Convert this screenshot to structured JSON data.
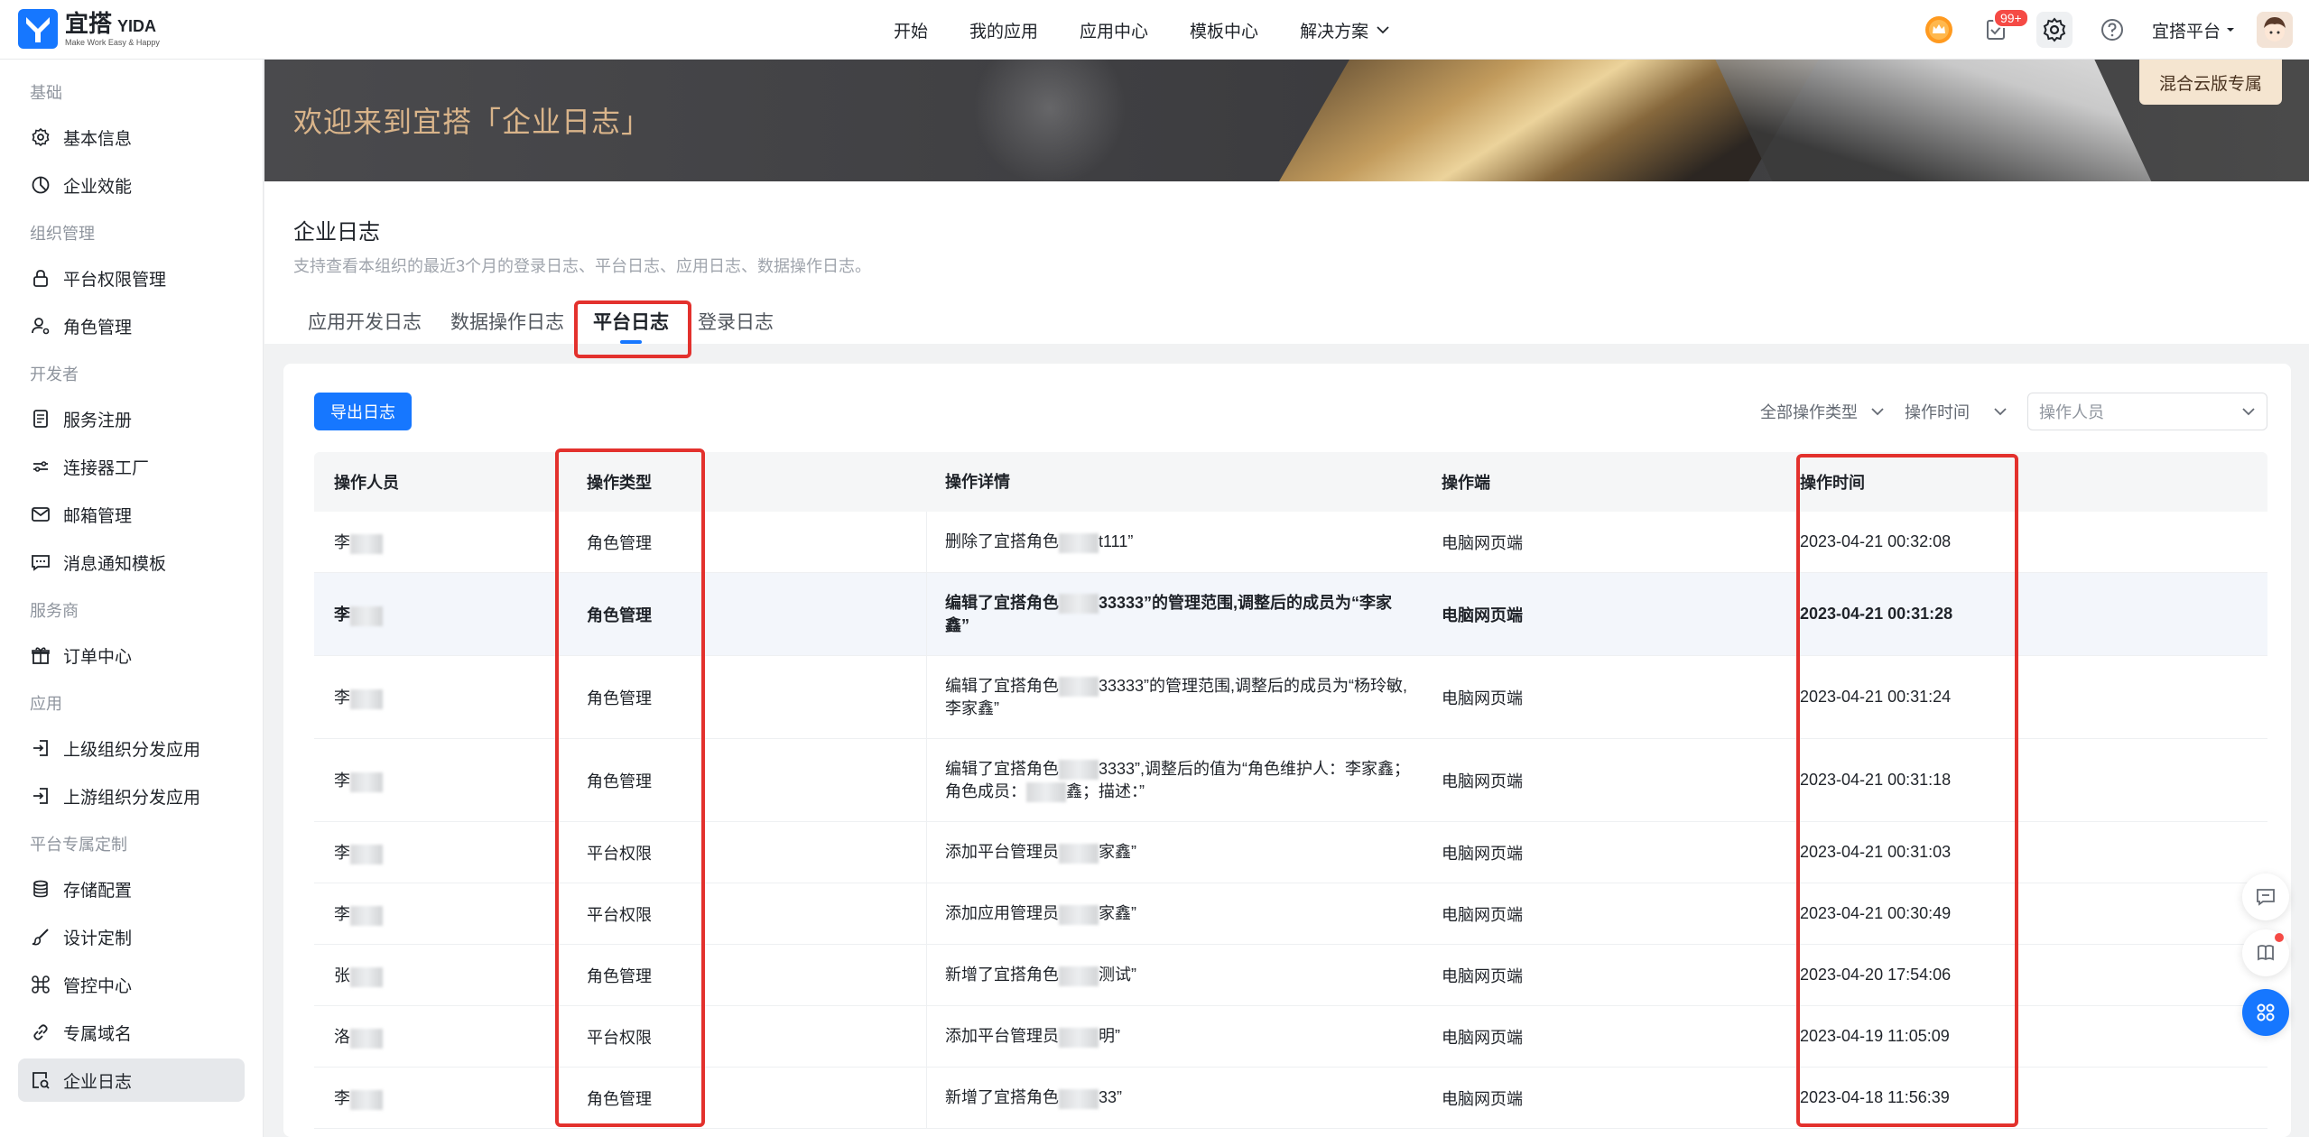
{
  "logo": {
    "cn": "宜搭",
    "en": "YIDA",
    "slogan": "Make Work Easy & Happy"
  },
  "topnav": {
    "items": [
      {
        "label": "开始"
      },
      {
        "label": "我的应用"
      },
      {
        "label": "应用中心"
      },
      {
        "label": "模板中心"
      },
      {
        "label": "解决方案"
      }
    ],
    "notification_badge": "99+",
    "org_name": "宜搭平台"
  },
  "sidebar": {
    "groups": [
      {
        "title": "基础",
        "items": [
          {
            "label": "基本信息",
            "icon": "gear-icon"
          },
          {
            "label": "企业效能",
            "icon": "pie-chart-icon"
          }
        ]
      },
      {
        "title": "组织管理",
        "items": [
          {
            "label": "平台权限管理",
            "icon": "lock-icon"
          },
          {
            "label": "角色管理",
            "icon": "user-gear-icon"
          }
        ]
      },
      {
        "title": "开发者",
        "items": [
          {
            "label": "服务注册",
            "icon": "document-icon"
          },
          {
            "label": "连接器工厂",
            "icon": "connector-icon"
          },
          {
            "label": "邮箱管理",
            "icon": "mail-icon"
          },
          {
            "label": "消息通知模板",
            "icon": "message-icon"
          }
        ]
      },
      {
        "title": "服务商",
        "items": [
          {
            "label": "订单中心",
            "icon": "gift-icon"
          }
        ]
      },
      {
        "title": "应用",
        "items": [
          {
            "label": "上级组织分发应用",
            "icon": "login-icon"
          },
          {
            "label": "上游组织分发应用",
            "icon": "login-icon"
          }
        ]
      },
      {
        "title": "平台专属定制",
        "items": [
          {
            "label": "存储配置",
            "icon": "database-icon"
          },
          {
            "label": "设计定制",
            "icon": "brush-icon"
          },
          {
            "label": "管控中心",
            "icon": "command-icon"
          },
          {
            "label": "专属域名",
            "icon": "link-icon"
          },
          {
            "label": "企业日志",
            "icon": "log-search-icon"
          }
        ]
      }
    ],
    "active_item": "企业日志"
  },
  "banner": {
    "title": "欢迎来到宜搭「企业日志」",
    "cloud_badge": "混合云版专属"
  },
  "page": {
    "title": "企业日志",
    "description": "支持查看本组织的最近3个月的登录日志、平台日志、应用日志、数据操作日志。",
    "tabs": [
      {
        "label": "应用开发日志"
      },
      {
        "label": "数据操作日志"
      },
      {
        "label": "平台日志"
      },
      {
        "label": "登录日志"
      }
    ],
    "active_tab": "平台日志"
  },
  "toolbar": {
    "export_label": "导出日志",
    "filter_type": "全部操作类型",
    "filter_time": "操作时间",
    "filter_operator_placeholder": "操作人员"
  },
  "table": {
    "columns": [
      "操作人员",
      "操作类型",
      "操作详情",
      "操作端",
      "操作时间"
    ],
    "rows": [
      {
        "operator": "李",
        "type": "角色管理",
        "detail_a": "删除了宜搭角色",
        "detail_b": "t111”",
        "client": "电脑网页端",
        "time": "2023-04-21 00:32:08"
      },
      {
        "operator": "李",
        "type": "角色管理",
        "detail_a": "编辑了宜搭角色",
        "detail_b": "33333”的管理范围,调整后的成员为“李家鑫”",
        "client": "电脑网页端",
        "time": "2023-04-21 00:31:28"
      },
      {
        "operator": "李",
        "type": "角色管理",
        "detail_a": "编辑了宜搭角色",
        "detail_b": "33333”的管理范围,调整后的成员为“杨玲敏,李家鑫”",
        "client": "电脑网页端",
        "time": "2023-04-21 00:31:24"
      },
      {
        "operator": "李",
        "type": "角色管理",
        "detail_a": "编辑了宜搭角色",
        "detail_b": "3333”,调整后的值为“角色维护人：李家鑫；角色成员：",
        "detail_c": "鑫；描述：”",
        "client": "电脑网页端",
        "time": "2023-04-21 00:31:18"
      },
      {
        "operator": "李",
        "type": "平台权限",
        "detail_a": "添加平台管理员",
        "detail_b": "家鑫”",
        "client": "电脑网页端",
        "time": "2023-04-21 00:31:03"
      },
      {
        "operator": "李",
        "type": "平台权限",
        "detail_a": "添加应用管理员",
        "detail_b": "家鑫”",
        "client": "电脑网页端",
        "time": "2023-04-21 00:30:49"
      },
      {
        "operator": "张",
        "type": "角色管理",
        "detail_a": "新增了宜搭角色",
        "detail_b": "测试”",
        "client": "电脑网页端",
        "time": "2023-04-20 17:54:06"
      },
      {
        "operator": "洛",
        "type": "平台权限",
        "detail_a": "添加平台管理员",
        "detail_b": "明”",
        "client": "电脑网页端",
        "time": "2023-04-19 11:05:09"
      },
      {
        "operator": "李",
        "type": "角色管理",
        "detail_a": "新增了宜搭角色",
        "detail_b": "33”",
        "client": "电脑网页端",
        "time": "2023-04-18 11:56:39"
      }
    ]
  },
  "colors": {
    "primary": "#1677ff",
    "highlight_box": "#e3312d",
    "banner_title": "#d9b48a"
  }
}
